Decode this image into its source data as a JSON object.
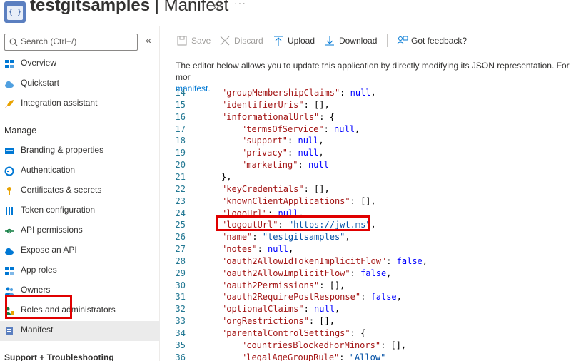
{
  "header": {
    "app_name": "testgitsamples",
    "separator": " | ",
    "blade_title": "Manifest",
    "app_icon_text": "{ }",
    "more": "···"
  },
  "sidebar": {
    "search_placeholder": "Search (Ctrl+/)",
    "collapse_glyph": "«",
    "top_items": [
      {
        "label": "Overview",
        "icon": "overview-grid-icon"
      },
      {
        "label": "Quickstart",
        "icon": "cloud-icon"
      },
      {
        "label": "Integration assistant",
        "icon": "rocket-icon"
      }
    ],
    "manage_heading": "Manage",
    "manage_items": [
      {
        "label": "Branding & properties",
        "icon": "branding-icon"
      },
      {
        "label": "Authentication",
        "icon": "authentication-icon"
      },
      {
        "label": "Certificates & secrets",
        "icon": "key-icon"
      },
      {
        "label": "Token configuration",
        "icon": "token-bars-icon"
      },
      {
        "label": "API permissions",
        "icon": "api-permissions-icon"
      },
      {
        "label": "Expose an API",
        "icon": "cloud-api-icon"
      },
      {
        "label": "App roles",
        "icon": "app-roles-icon"
      },
      {
        "label": "Owners",
        "icon": "owners-icon"
      },
      {
        "label": "Roles and administrators",
        "icon": "roles-icon"
      },
      {
        "label": "Manifest",
        "icon": "manifest-icon",
        "selected": true
      }
    ],
    "support_heading": "Support + Troubleshooting"
  },
  "toolbar": {
    "save": "Save",
    "discard": "Discard",
    "upload": "Upload",
    "download": "Download",
    "feedback": "Got feedback?"
  },
  "description": {
    "text": "The editor below allows you to update this application by directly modifying its JSON representation. For mor",
    "link": "manifest."
  },
  "editor": {
    "lines": [
      {
        "n": "14",
        "html": "<span class=\"k\">\"groupMembershipClaims\"</span><span class=\"p\">: </span><span class=\"kw\">null</span><span class=\"p\">,</span>",
        "indent": 1
      },
      {
        "n": "15",
        "indent": 1
      },
      {
        "n": "16",
        "indent": 1
      },
      {
        "n": "17",
        "indent": 2
      },
      {
        "n": "18",
        "indent": 2
      },
      {
        "n": "19",
        "indent": 2
      },
      {
        "n": "20",
        "indent": 2
      },
      {
        "n": "21",
        "indent": 1
      },
      {
        "n": "22",
        "indent": 1
      },
      {
        "n": "23",
        "indent": 1
      },
      {
        "n": "24",
        "indent": 1
      },
      {
        "n": "25",
        "indent": 1
      },
      {
        "n": "26",
        "indent": 1
      },
      {
        "n": "27",
        "indent": 1
      },
      {
        "n": "28",
        "indent": 1
      },
      {
        "n": "29",
        "indent": 1
      },
      {
        "n": "30",
        "indent": 1
      },
      {
        "n": "31",
        "indent": 1
      },
      {
        "n": "32",
        "indent": 1
      },
      {
        "n": "33",
        "indent": 1
      },
      {
        "n": "34",
        "indent": 1
      },
      {
        "n": "35",
        "indent": 2
      },
      {
        "n": "36",
        "indent": 2
      }
    ],
    "tokens": [
      [
        [
          "k",
          "\"groupMembershipClaims\""
        ],
        [
          "p",
          ": "
        ],
        [
          "kw",
          "null"
        ],
        [
          "p",
          ","
        ]
      ],
      [
        [
          "k",
          "\"identifierUris\""
        ],
        [
          "p",
          ": [],"
        ]
      ],
      [
        [
          "k",
          "\"informationalUrls\""
        ],
        [
          "p",
          ": {"
        ]
      ],
      [
        [
          "k",
          "\"termsOfService\""
        ],
        [
          "p",
          ": "
        ],
        [
          "kw",
          "null"
        ],
        [
          "p",
          ","
        ]
      ],
      [
        [
          "k",
          "\"support\""
        ],
        [
          "p",
          ": "
        ],
        [
          "kw",
          "null"
        ],
        [
          "p",
          ","
        ]
      ],
      [
        [
          "k",
          "\"privacy\""
        ],
        [
          "p",
          ": "
        ],
        [
          "kw",
          "null"
        ],
        [
          "p",
          ","
        ]
      ],
      [
        [
          "k",
          "\"marketing\""
        ],
        [
          "p",
          ": "
        ],
        [
          "kw",
          "null"
        ]
      ],
      [
        [
          "p",
          "},"
        ]
      ],
      [
        [
          "k",
          "\"keyCredentials\""
        ],
        [
          "p",
          ": [],"
        ]
      ],
      [
        [
          "k",
          "\"knownClientApplications\""
        ],
        [
          "p",
          ": [],"
        ]
      ],
      [
        [
          "k",
          "\"logoUrl\""
        ],
        [
          "p",
          ": "
        ],
        [
          "kw",
          "null"
        ],
        [
          "p",
          ","
        ]
      ],
      [
        [
          "k",
          "\"logoutUrl\""
        ],
        [
          "p",
          ": "
        ],
        [
          "s",
          "\"https://jwt.ms\""
        ],
        [
          "p",
          ","
        ]
      ],
      [
        [
          "k",
          "\"name\""
        ],
        [
          "p",
          ": "
        ],
        [
          "s",
          "\"testgitsamples\""
        ],
        [
          "p",
          ","
        ]
      ],
      [
        [
          "k",
          "\"notes\""
        ],
        [
          "p",
          ": "
        ],
        [
          "kw",
          "null"
        ],
        [
          "p",
          ","
        ]
      ],
      [
        [
          "k",
          "\"oauth2AllowIdTokenImplicitFlow\""
        ],
        [
          "p",
          ": "
        ],
        [
          "kw",
          "false"
        ],
        [
          "p",
          ","
        ]
      ],
      [
        [
          "k",
          "\"oauth2AllowImplicitFlow\""
        ],
        [
          "p",
          ": "
        ],
        [
          "kw",
          "false"
        ],
        [
          "p",
          ","
        ]
      ],
      [
        [
          "k",
          "\"oauth2Permissions\""
        ],
        [
          "p",
          ": [],"
        ]
      ],
      [
        [
          "k",
          "\"oauth2RequirePostResponse\""
        ],
        [
          "p",
          ": "
        ],
        [
          "kw",
          "false"
        ],
        [
          "p",
          ","
        ]
      ],
      [
        [
          "k",
          "\"optionalClaims\""
        ],
        [
          "p",
          ": "
        ],
        [
          "kw",
          "null"
        ],
        [
          "p",
          ","
        ]
      ],
      [
        [
          "k",
          "\"orgRestrictions\""
        ],
        [
          "p",
          ": [],"
        ]
      ],
      [
        [
          "k",
          "\"parentalControlSettings\""
        ],
        [
          "p",
          ": {"
        ]
      ],
      [
        [
          "k",
          "\"countriesBlockedForMinors\""
        ],
        [
          "p",
          ": [],"
        ]
      ],
      [
        [
          "k",
          "\"legalAgeGroupRule\""
        ],
        [
          "p",
          ": "
        ],
        [
          "s",
          "\"Allow\""
        ]
      ]
    ]
  }
}
